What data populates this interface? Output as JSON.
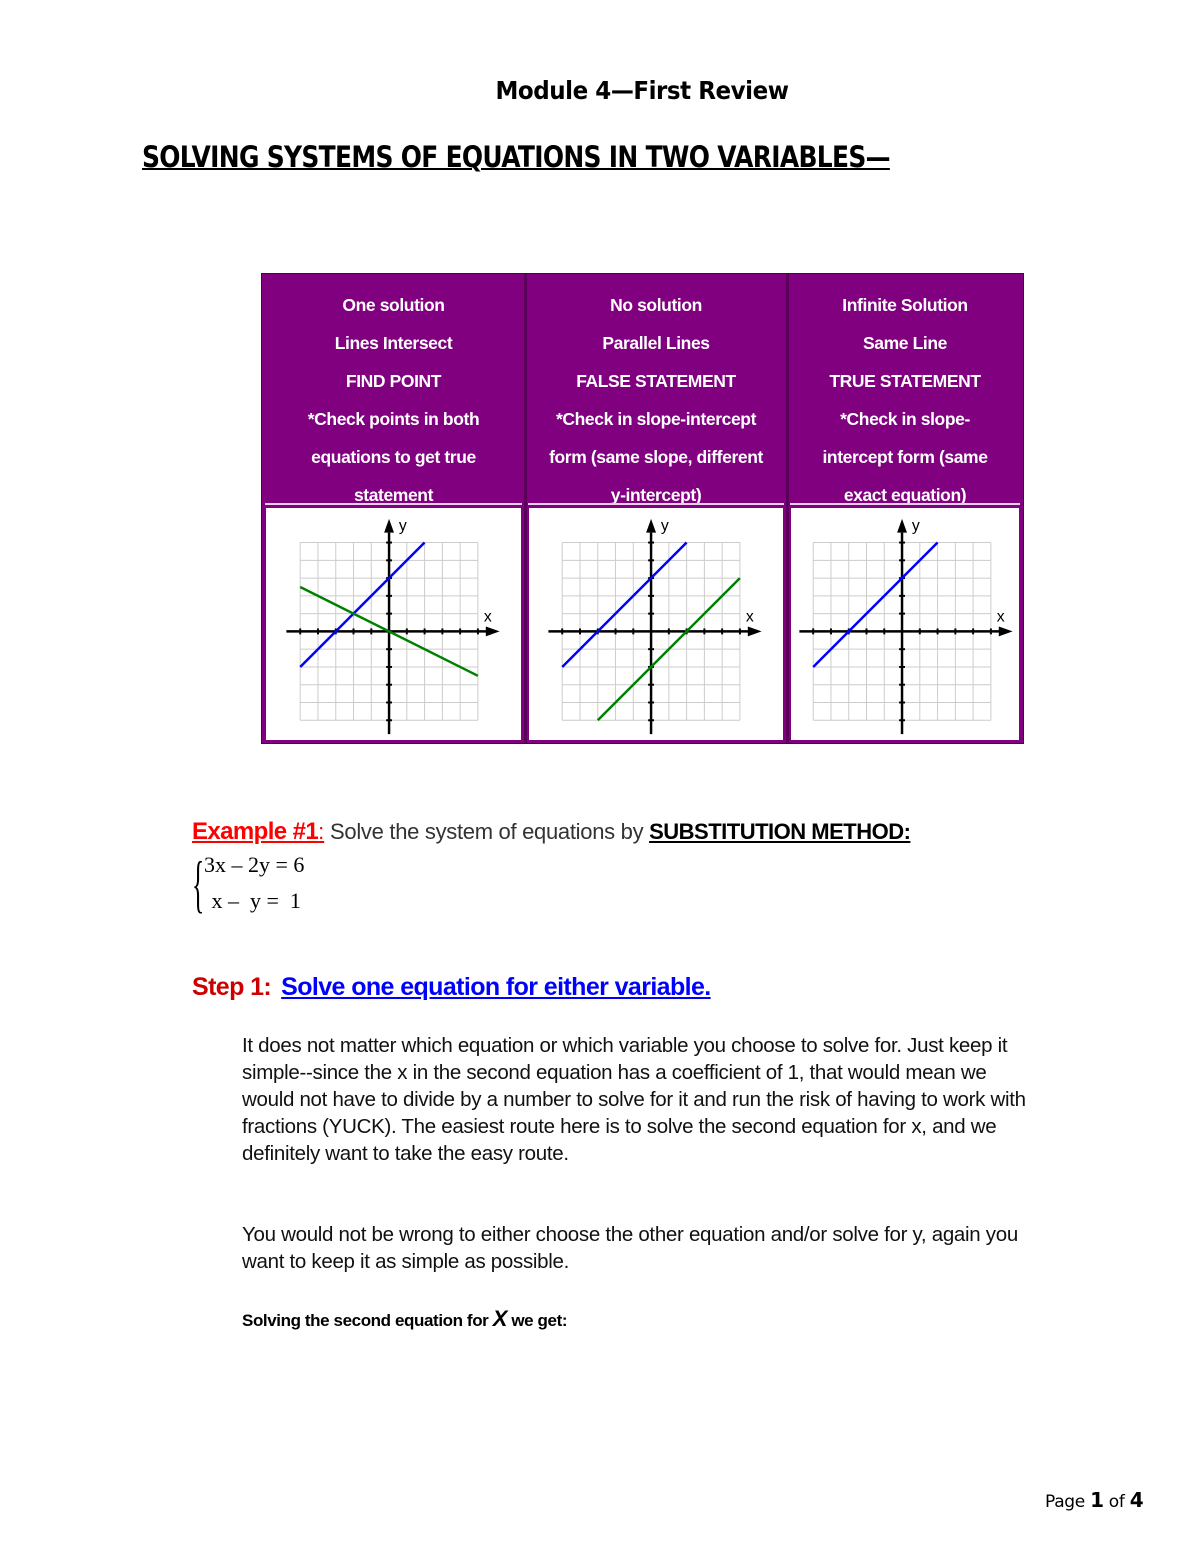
{
  "header": {
    "module_title": "Module 4—First Review",
    "main_heading": "SOLVING SYSTEMS OF EQUATIONS IN TWO VARIABLES—"
  },
  "colors": {
    "table_bg": "#800080",
    "line_blue": "#0000ff",
    "line_green": "#008000",
    "example_red": "#ff0000",
    "step_red": "#cc0000",
    "step_blue": "#0000ff"
  },
  "cases": [
    {
      "lines": [
        "One solution",
        "Lines Intersect",
        "FIND POINT",
        "*Check points in both",
        "equations to get true",
        "statement"
      ],
      "graph": {
        "x_label": "x",
        "y_label": "y",
        "range": [
          -5,
          5
        ],
        "lines": [
          {
            "name": "blue-line",
            "color": "#0000ff",
            "from": [
              -5,
              -2
            ],
            "to": [
              2,
              5
            ]
          },
          {
            "name": "green-line",
            "color": "#008000",
            "from": [
              -5,
              2.5
            ],
            "to": [
              5,
              -2.5
            ]
          }
        ]
      }
    },
    {
      "lines": [
        "No solution",
        "Parallel Lines",
        "FALSE STATEMENT",
        "*Check in slope-intercept",
        "form (same slope, different",
        "y-intercept)"
      ],
      "graph": {
        "x_label": "x",
        "y_label": "y",
        "range": [
          -5,
          5
        ],
        "lines": [
          {
            "name": "blue-line",
            "color": "#0000ff",
            "from": [
              -5,
              -2
            ],
            "to": [
              2,
              5
            ]
          },
          {
            "name": "green-line",
            "color": "#008000",
            "from": [
              -3,
              -5
            ],
            "to": [
              5,
              3
            ]
          }
        ]
      }
    },
    {
      "lines": [
        "Infinite Solution",
        "Same Line",
        "TRUE STATEMENT",
        "*Check in slope-",
        "intercept form (same",
        "exact equation)"
      ],
      "graph": {
        "x_label": "x",
        "y_label": "y",
        "range": [
          -5,
          5
        ],
        "lines": [
          {
            "name": "blue-line",
            "color": "#0000ff",
            "from": [
              -5,
              -2
            ],
            "to": [
              2,
              5
            ]
          }
        ]
      }
    }
  ],
  "example": {
    "label": "Example #1",
    "colon": ":",
    "text": " Solve the system of equations by ",
    "method": "SUBSTITUTION METHOD:",
    "equations": [
      "3x – 2y = 6",
      " x –  y =  1"
    ]
  },
  "step1": {
    "label": "Step 1:",
    "text": "Solve one equation for either variable."
  },
  "paragraphs": [
    "It does not matter which equation or which variable you choose to solve for. Just keep it simple--since the x in the second equation has a coefficient of 1, that would mean we would not have to divide by a number to solve for it and run the risk of having to work with fractions (YUCK). The easiest route here is to solve the second equation for x, and we definitely want to take the easy route.",
    "You would not be wrong to either choose the other equation and/or solve for y, again you want to keep it as simple as possible."
  ],
  "solving_line": {
    "before": "Solving the second equation for ",
    "var": "X",
    "after": " we get:"
  },
  "footer": {
    "page_word": "Page ",
    "page_current": "1",
    "of_word": " of ",
    "page_total": "4"
  }
}
